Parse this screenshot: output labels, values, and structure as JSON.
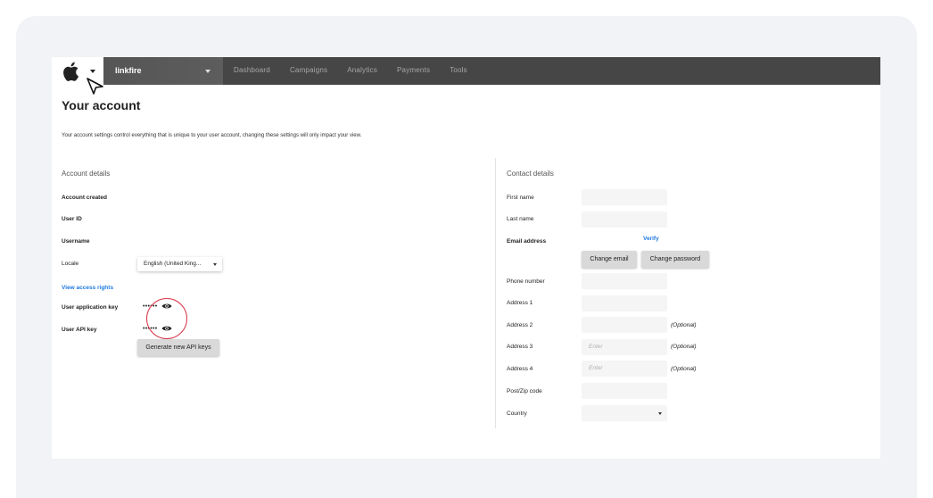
{
  "navbar": {
    "org_name": "linkfire",
    "items": [
      "Dashboard",
      "Campaigns",
      "Analytics",
      "Payments",
      "Tools"
    ]
  },
  "page": {
    "title": "Your account",
    "intro": "Your account settings control everything that is unique to your user account, changing these settings will only impact your view."
  },
  "account": {
    "section_title": "Account details",
    "account_created": "Account created",
    "user_id": "User ID",
    "username": "Username",
    "locale_label": "Locale",
    "locale_value": "English (United King...",
    "access_link": "View access rights",
    "app_key_label": "User application key",
    "app_key_masked": "••••••",
    "api_key_label": "User API key",
    "api_key_masked": "••••••",
    "generate_button": "Generate new API keys"
  },
  "contact": {
    "section_title": "Contact details",
    "first_name": "First name",
    "last_name": "Last name",
    "email": "Email address",
    "verify_link": "Verify",
    "change_email": "Change email",
    "change_password": "Change password",
    "phone": "Phone number",
    "address1": "Address 1",
    "address2": "Address 2",
    "address3": "Address 3",
    "address4": "Address 4",
    "postcode": "Post/Zip code",
    "country": "Country",
    "enter_placeholder": "Enter",
    "optional": "(Optional)"
  },
  "colors": {
    "navbar": "#464646",
    "link": "#1f7ae0",
    "highlight": "#d9364a"
  }
}
